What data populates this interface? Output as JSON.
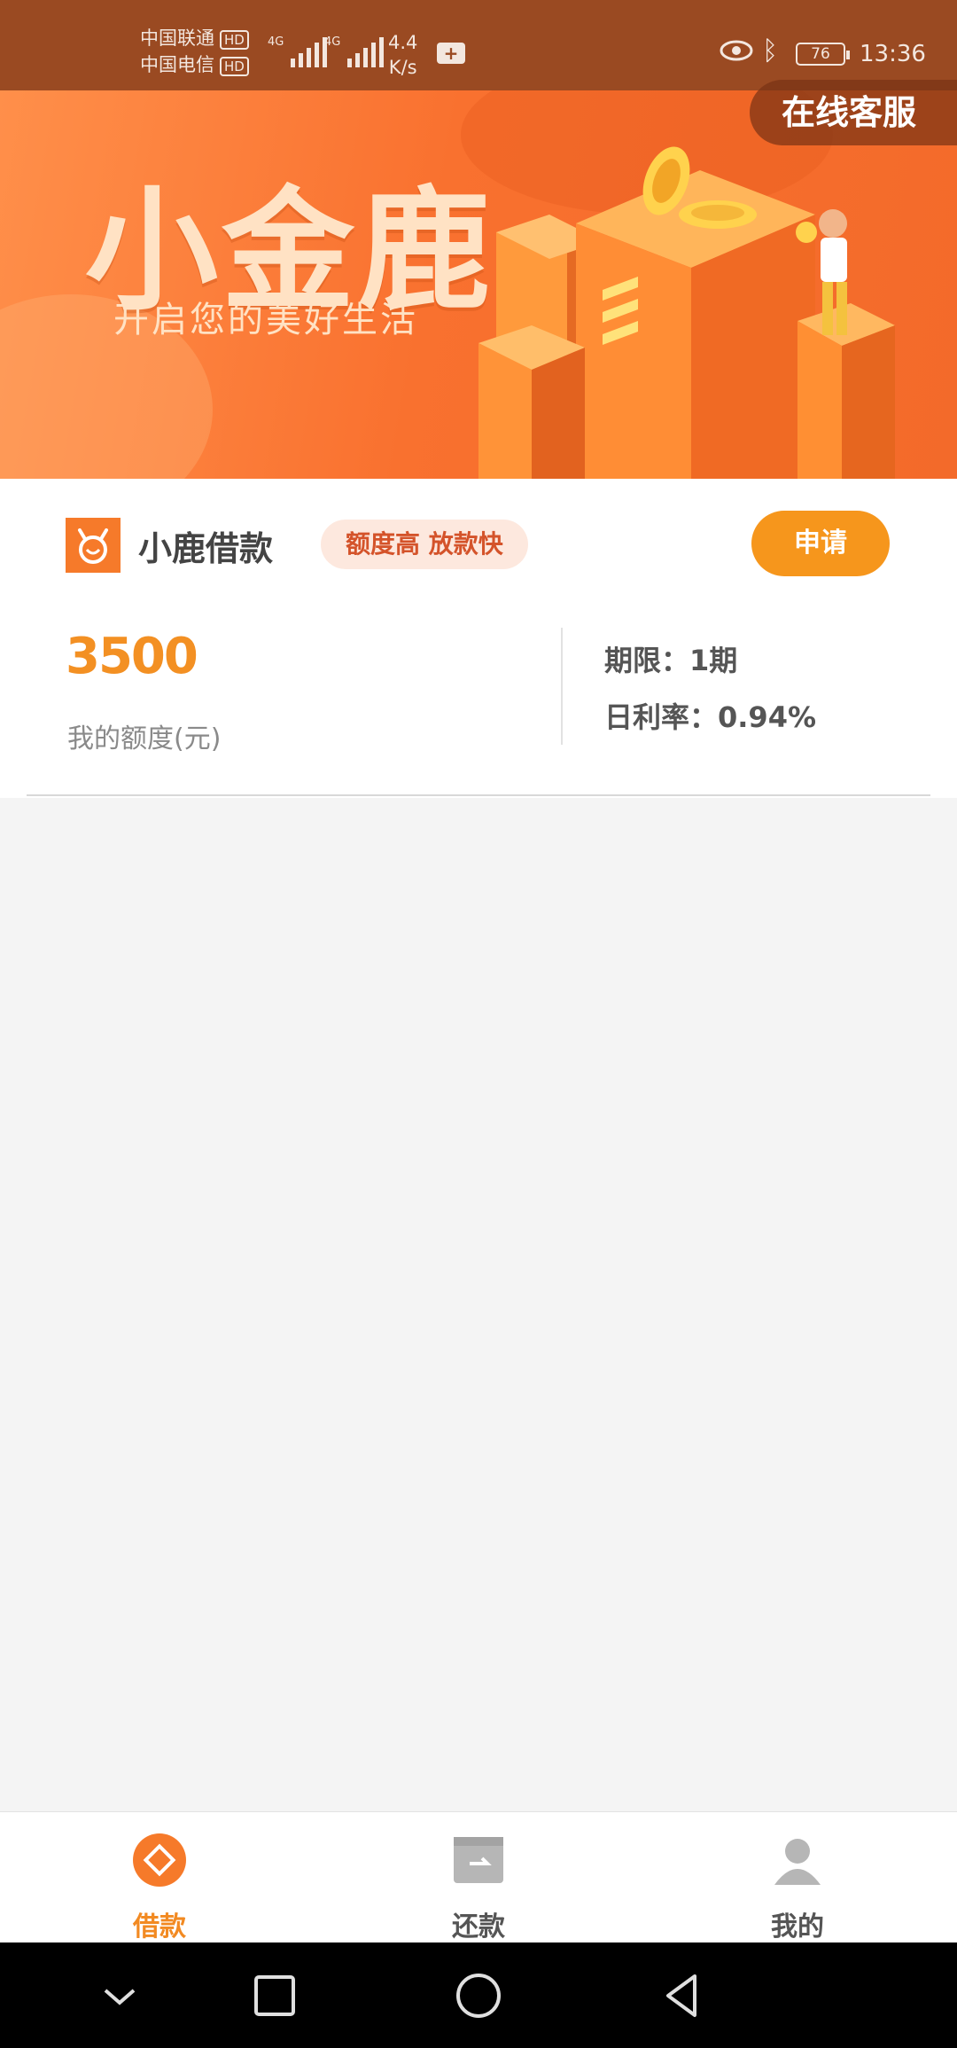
{
  "status_bar": {
    "carrier1": "中国联通",
    "carrier2": "中国电信",
    "hd": "HD",
    "net1": "4G",
    "net2": "4G",
    "speed_value": "4.4",
    "speed_unit": "K/s",
    "battery": "76",
    "time": "13:36"
  },
  "banner": {
    "title": "小金鹿",
    "subtitle": "开启您的美好生活",
    "customer_service": "在线客服"
  },
  "product": {
    "name": "小鹿借款",
    "tag": "额度高 放款快",
    "apply_label": "申请",
    "amount": "3500",
    "amount_label": "我的额度(元)",
    "term": "期限：1期",
    "rate": "日利率：0.94%"
  },
  "tabs": [
    {
      "label": "借款",
      "icon": "loan-icon",
      "active": true
    },
    {
      "label": "还款",
      "icon": "repay-icon",
      "active": false
    },
    {
      "label": "我的",
      "icon": "profile-icon",
      "active": false
    }
  ],
  "colors": {
    "accent": "#f39023",
    "banner": "#f9712f",
    "tag_bg": "#fde8de",
    "tag_text": "#d4532a"
  }
}
